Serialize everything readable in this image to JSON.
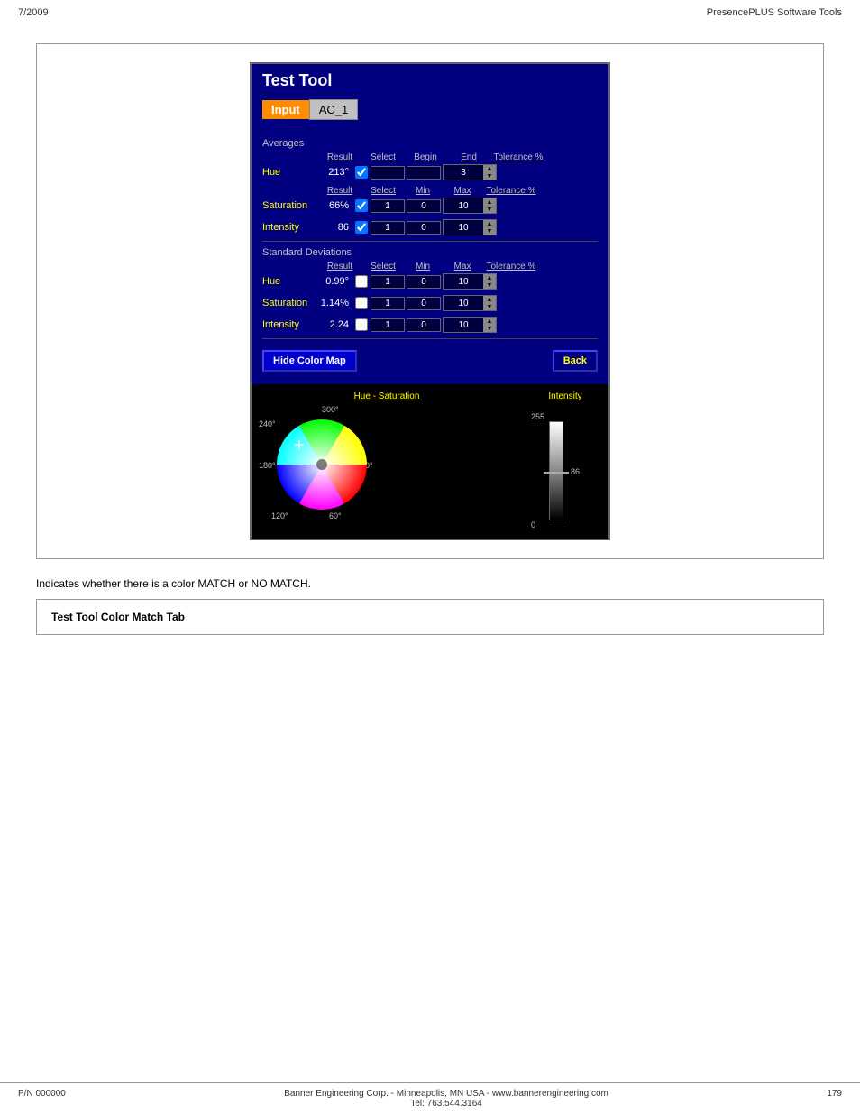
{
  "header": {
    "date": "7/2009",
    "title": "PresencePLUS Software Tools"
  },
  "appWindow": {
    "title": "Test Tool",
    "tabs": [
      {
        "label": "Input",
        "active": true
      },
      {
        "label": "AC_1",
        "active": false
      }
    ],
    "sections": {
      "averages": {
        "label": "Averages",
        "hue": {
          "columns": [
            "Result",
            "Select",
            "Begin",
            "End",
            "Tolerance %"
          ],
          "result": "213°",
          "begin": "",
          "end": "",
          "tolerance": "3",
          "checked": true
        },
        "saturation": {
          "columns": [
            "Result",
            "Select",
            "Min",
            "Max",
            "Tolerance %"
          ],
          "result": "66%",
          "min": "1",
          "max": "0",
          "tolerance": "10",
          "checked": true
        },
        "intensity": {
          "label": "Intensity",
          "result": "86",
          "min": "1",
          "max": "0",
          "tolerance": "10",
          "checked": true
        }
      },
      "stdDev": {
        "label": "Standard Deviations",
        "hue": {
          "result": "0.99°",
          "min": "1",
          "max": "0",
          "tolerance": "10"
        },
        "saturation": {
          "result": "1.14%",
          "min": "1",
          "max": "0",
          "tolerance": "10"
        },
        "intensity": {
          "label": "Intensity",
          "result": "2.24",
          "min": "1",
          "max": "0",
          "tolerance": "10"
        }
      }
    },
    "buttons": {
      "hideColorMap": "Hide Color Map",
      "back": "Back"
    },
    "colorMap": {
      "hueSatTitle": "Hue - Saturation",
      "intensityTitle": "Intensity",
      "angles": {
        "top": "300°",
        "left240": "240°",
        "right0": "0°",
        "left180": "180°",
        "bottom120": "120°",
        "bottom60": "60°"
      },
      "intensityLabels": {
        "top": "255",
        "marker": "86",
        "bottom": "0"
      }
    }
  },
  "description": "Indicates whether there is a color MATCH or NO MATCH.",
  "colorMatchBox": {
    "title": "Test Tool Color Match Tab"
  },
  "footer": {
    "left": "P/N 000000",
    "center_line1": "Banner Engineering Corp. - Minneapolis, MN USA - www.bannerengineering.com",
    "center_line2": "Tel: 763.544.3164",
    "right": "179"
  }
}
